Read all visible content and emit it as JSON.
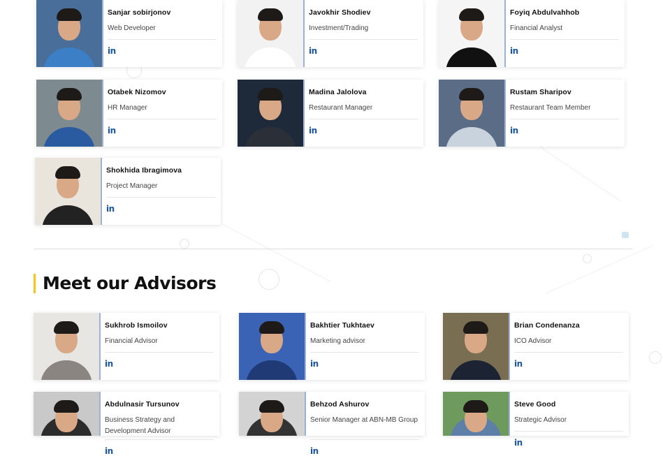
{
  "team": [
    {
      "name": "Sanjar sobirjonov",
      "role": "Web Developer",
      "link": "in",
      "bg": "#4a6e9a",
      "shirt": "#3d7fc7"
    },
    {
      "name": "Javokhir Shodiev",
      "role": "Investment/Trading",
      "link": "in",
      "bg": "#f2f2f2",
      "shirt": "#ffffff"
    },
    {
      "name": "Foyiq Abdulvahhob",
      "role": "Financial Analyst",
      "link": "in",
      "bg": "#f5f5f5",
      "shirt": "#111111"
    },
    {
      "name": "Otabek Nizomov",
      "role": "HR Manager",
      "link": "in",
      "bg": "#7d8a8f",
      "shirt": "#2a5aa0"
    },
    {
      "name": "Madina Jalolova",
      "role": "Restaurant Manager",
      "link": "in",
      "bg": "#1e2a3a",
      "shirt": "#2b2f38"
    },
    {
      "name": "Rustam Sharipov",
      "role": "Restaurant Team Member",
      "link": "in",
      "bg": "#5a6c86",
      "shirt": "#c9d3dd"
    },
    {
      "name": "Shokhida Ibragimova",
      "role": "Project Manager",
      "link": "in",
      "bg": "#e9e4dc",
      "shirt": "#222222"
    }
  ],
  "advisors_heading": "Meet our Advisors",
  "advisors": [
    {
      "name": "Sukhrob Ismoilov",
      "role": "Financial Advisor",
      "link": "in",
      "bg": "#e8e6e3",
      "shirt": "#8a8580"
    },
    {
      "name": "Bakhtier Tukhtaev",
      "role": "Marketing advisor",
      "link": "in",
      "bg": "#3b63b5",
      "shirt": "#1f3a75"
    },
    {
      "name": "Brian Condenanza",
      "role": "ICO Advisor",
      "link": "in",
      "bg": "#7a6e52",
      "shirt": "#1c2433"
    },
    {
      "name": "Abdulnasir Tursunov",
      "role": "Business Strategy and Development Advisor",
      "link": "in",
      "bg": "#c9c9c9",
      "shirt": "#2c2c2c"
    },
    {
      "name": "Behzod Ashurov",
      "role": "Senior Manager at ABN-MB Group",
      "link": "in",
      "bg": "#d3d3d3",
      "shirt": "#333333"
    },
    {
      "name": "Steve Good",
      "role": "Strategic Advisor",
      "link": "in",
      "bg": "#6f9a5d",
      "shirt": "#5d7fa8"
    }
  ]
}
